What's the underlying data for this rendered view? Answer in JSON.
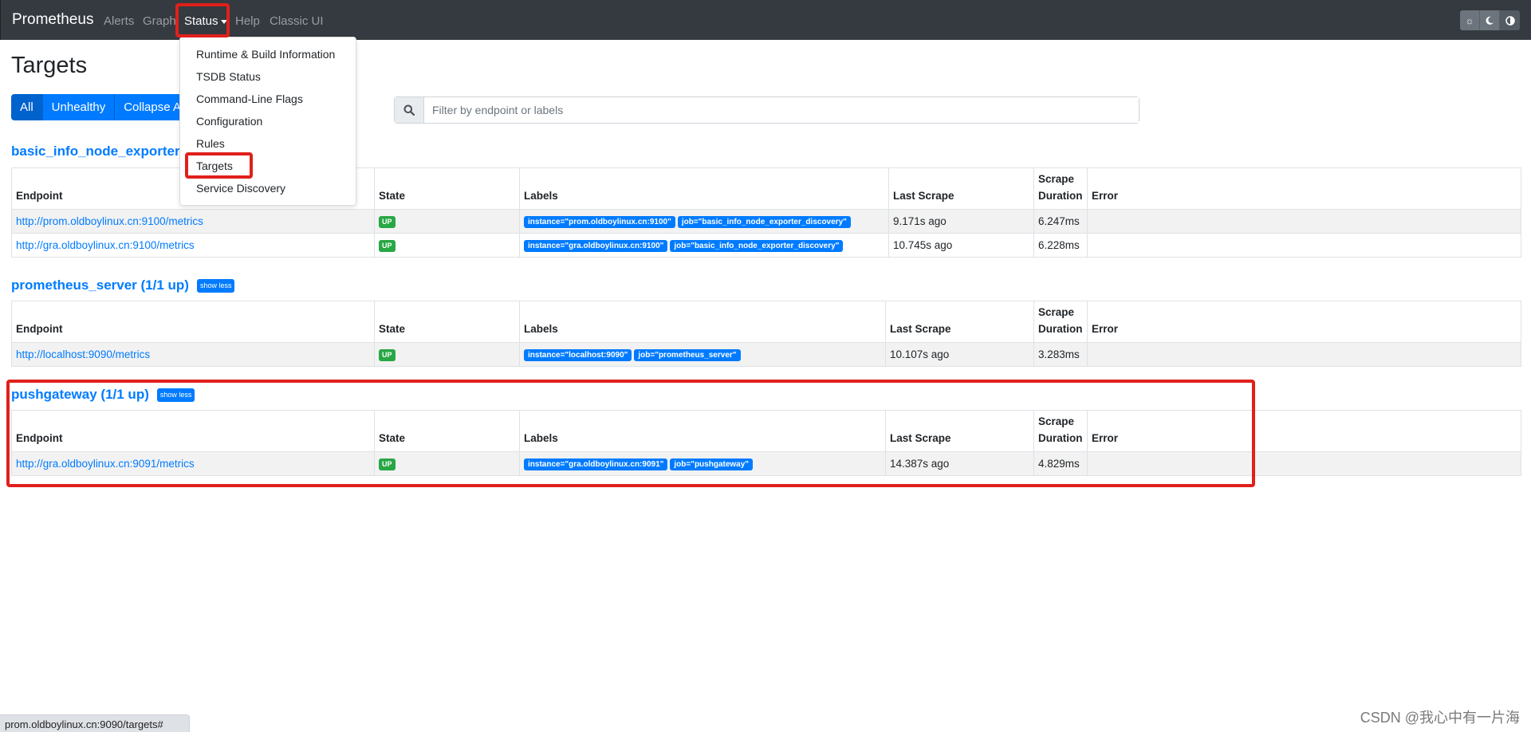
{
  "navbar": {
    "brand": "Prometheus",
    "links": [
      "Alerts",
      "Graph",
      "Status",
      "Help",
      "Classic UI"
    ],
    "theme_icons": [
      "sun-icon",
      "moon-icon",
      "contrast-icon"
    ]
  },
  "status_menu": {
    "items": [
      "Runtime & Build Information",
      "TSDB Status",
      "Command-Line Flags",
      "Configuration",
      "Rules",
      "Targets",
      "Service Discovery"
    ],
    "highlighted": "Targets"
  },
  "page": {
    "title": "Targets",
    "filters": [
      "All",
      "Unhealthy",
      "Collapse All"
    ],
    "active_filter": "All",
    "search_placeholder": "Filter by endpoint or labels"
  },
  "table_headers": {
    "endpoint": "Endpoint",
    "state": "State",
    "labels": "Labels",
    "last_scrape": "Last Scrape",
    "scrape_duration": "Scrape Duration",
    "error": "Error"
  },
  "pools": [
    {
      "title": "basic_info_node_exporter",
      "rows": [
        {
          "endpoint": "http://prom.oldboylinux.cn:9100/metrics",
          "state": "UP",
          "labels": [
            "instance=\"prom.oldboylinux.cn:9100\"",
            "job=\"basic_info_node_exporter_discovery\""
          ],
          "last_scrape": "9.171s ago",
          "duration": "6.247ms",
          "error": ""
        },
        {
          "endpoint": "http://gra.oldboylinux.cn:9100/metrics",
          "state": "UP",
          "labels": [
            "instance=\"gra.oldboylinux.cn:9100\"",
            "job=\"basic_info_node_exporter_discovery\""
          ],
          "last_scrape": "10.745s ago",
          "duration": "6.228ms",
          "error": ""
        }
      ]
    },
    {
      "title": "prometheus_server (1/1 up)",
      "show_less": "show less",
      "rows": [
        {
          "endpoint": "http://localhost:9090/metrics",
          "state": "UP",
          "labels": [
            "instance=\"localhost:9090\"",
            "job=\"prometheus_server\""
          ],
          "last_scrape": "10.107s ago",
          "duration": "3.283ms",
          "error": ""
        }
      ]
    },
    {
      "title": "pushgateway (1/1 up)",
      "show_less": "show less",
      "rows": [
        {
          "endpoint": "http://gra.oldboylinux.cn:9091/metrics",
          "state": "UP",
          "labels": [
            "instance=\"gra.oldboylinux.cn:9091\"",
            "job=\"pushgateway\""
          ],
          "last_scrape": "14.387s ago",
          "duration": "4.829ms",
          "error": ""
        }
      ]
    }
  ],
  "status_bar": "prom.oldboylinux.cn:9090/targets#",
  "watermark": "CSDN @我心中有一片海",
  "colors": {
    "navbar": "#343a40",
    "primary": "#007bff",
    "success": "#28a745",
    "annotation": "#e0201b"
  }
}
